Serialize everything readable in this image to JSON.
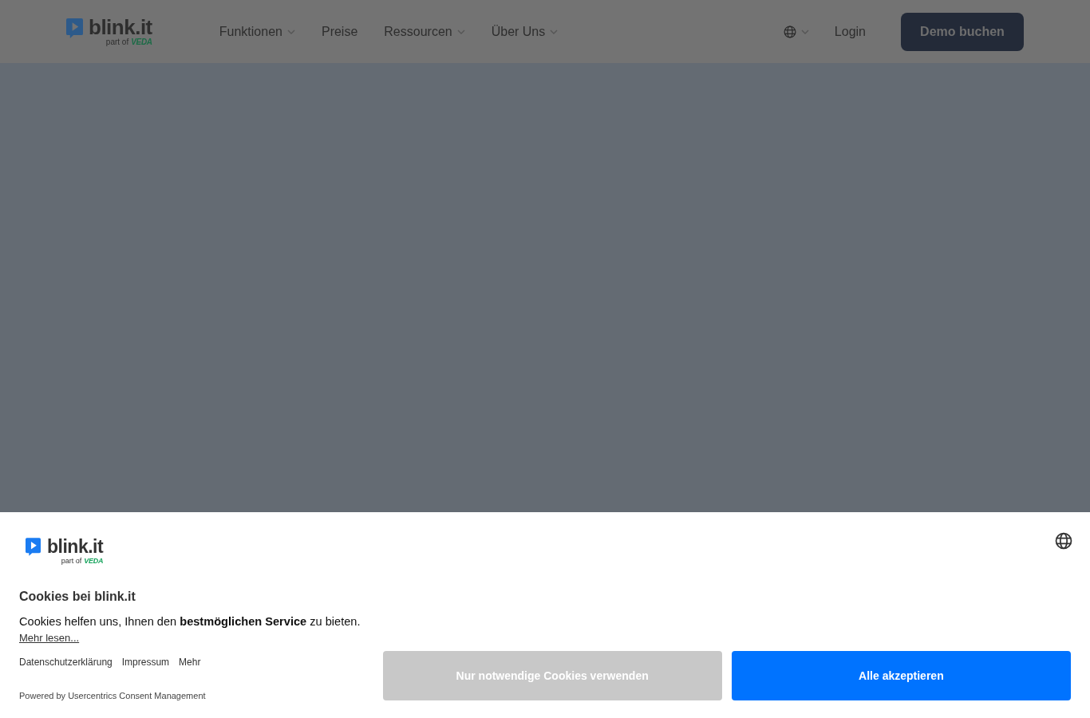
{
  "header": {
    "logo": {
      "name": "blink.it",
      "tagline": "part of",
      "partner": "VEDA"
    },
    "nav": [
      {
        "label": "Funktionen",
        "dropdown": true
      },
      {
        "label": "Preise",
        "dropdown": false
      },
      {
        "label": "Ressourcen",
        "dropdown": true
      },
      {
        "label": "Über Uns",
        "dropdown": true
      }
    ],
    "login": "Login",
    "cta": "Demo buchen"
  },
  "cookie_banner": {
    "logo": {
      "name": "blink.it",
      "tagline": "part of",
      "partner": "VEDA"
    },
    "title": "Cookies bei blink.it",
    "text": "Cookies helfen uns, Ihnen den **bestmöglichen Service** zu bieten.",
    "read_more": "Mehr lesen...",
    "links": [
      "Datenschutzerklärung",
      "Impressum",
      "Mehr"
    ],
    "powered_by": "Powered by Usercentrics Consent Management",
    "buttons": [
      {
        "label": "Nur notwendige Cookies verwenden",
        "kind": "secondary"
      },
      {
        "label": "Alle akzeptieren",
        "kind": "primary"
      }
    ]
  }
}
